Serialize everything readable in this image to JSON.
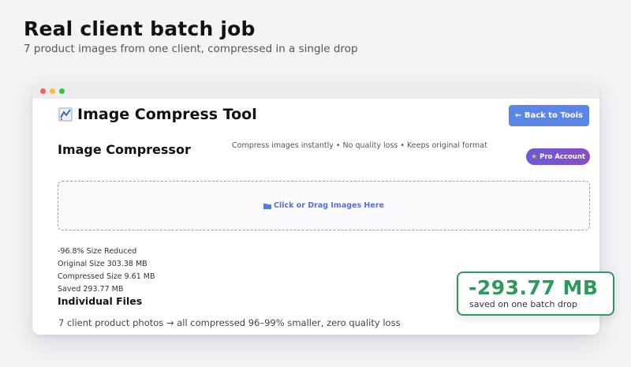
{
  "header": {
    "title": "Real client batch job",
    "subtitle": "7 product images from one client, compressed in a single drop"
  },
  "app": {
    "logo_icon": "chart-icon",
    "name": "Image Compress Tool",
    "back_button": "← Back to Tools",
    "section_title": "Image Compressor",
    "tagline": "Compress images instantly • No quality loss • Keeps original format",
    "pro_badge": "Pro Account",
    "dropzone_label": "Click or Drag Images Here",
    "stats": {
      "reduced": "-96.8% Size Reduced",
      "original": "Original Size 303.38 MB",
      "compressed": "Compressed Size 9.61 MB",
      "saved": "Saved 293.77 MB"
    },
    "files_heading": "Individual Files",
    "caption": "7 client product photos → all compressed 96–99% smaller, zero quality loss"
  },
  "callout": {
    "value": "-293.77 MB",
    "label": "saved on one batch drop"
  },
  "colors": {
    "accent": "#5a86e8",
    "success": "#2e9a5a",
    "badge": "#7a54cc"
  }
}
